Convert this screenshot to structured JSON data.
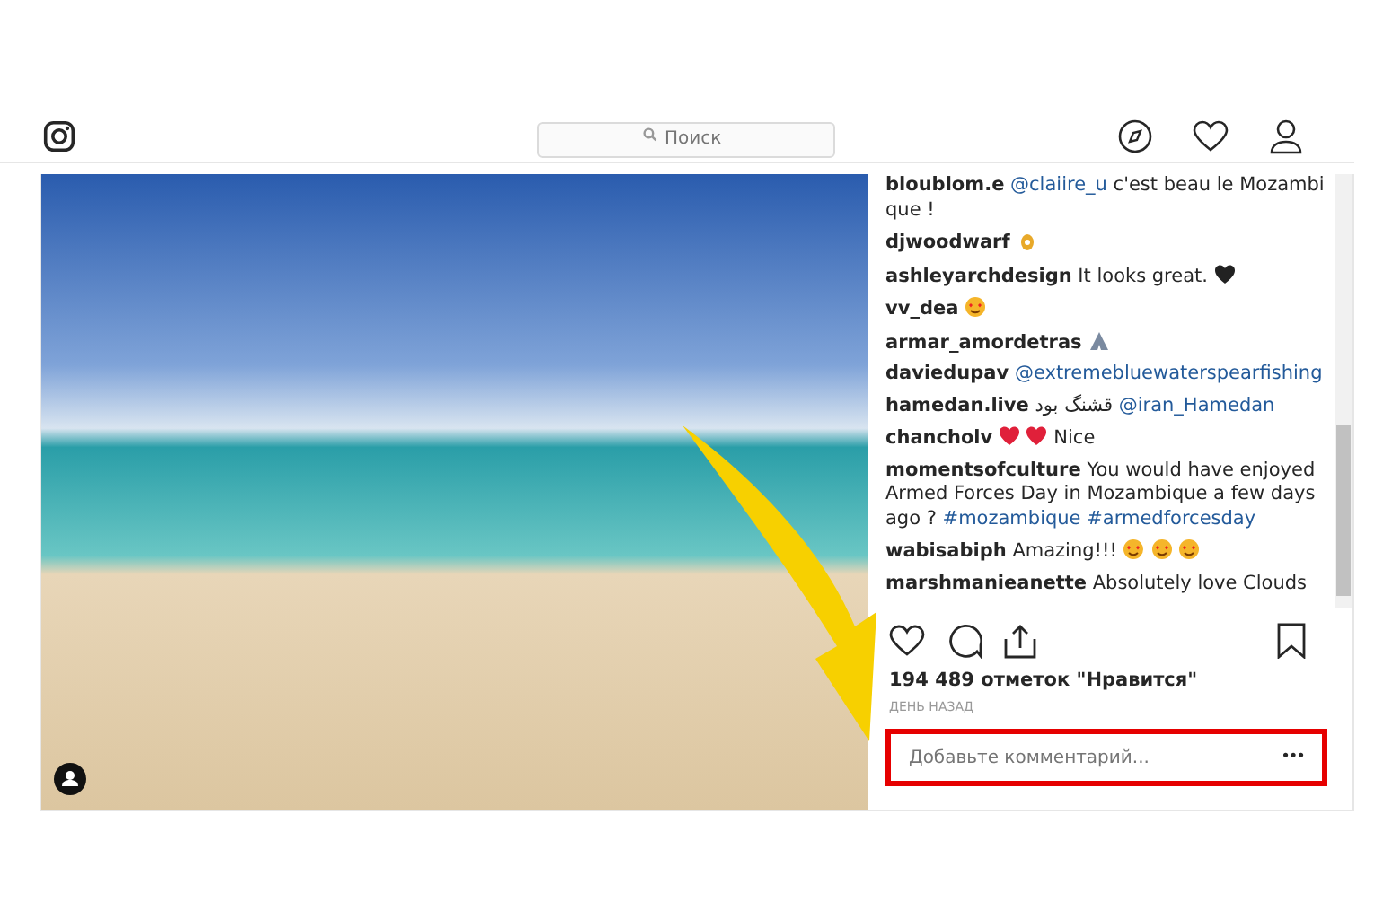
{
  "header": {
    "search": {
      "placeholder": "Поиск"
    }
  },
  "comments": [
    {
      "user": "bloublom.e",
      "parts": [
        {
          "kind": "mention",
          "text": "@claiire_u"
        },
        {
          "kind": "text",
          "text": "c'est beau le Mozambique !"
        }
      ]
    },
    {
      "user": "djwoodwarf",
      "parts": [
        {
          "kind": "ok-hand"
        }
      ]
    },
    {
      "user": "ashleyarchdesign",
      "parts": [
        {
          "kind": "text",
          "text": "It looks great."
        },
        {
          "kind": "black-heart"
        }
      ]
    },
    {
      "user": "vv_dea",
      "parts": [
        {
          "kind": "heart-eyes"
        }
      ]
    },
    {
      "user": "armar_amordetras",
      "parts": [
        {
          "kind": "pray"
        }
      ]
    },
    {
      "user": "daviedupav",
      "parts": [
        {
          "kind": "mention",
          "text": "@extremebluewaterspearfishing"
        }
      ]
    },
    {
      "user": "hamedan.live",
      "parts": [
        {
          "kind": "text",
          "text": "قشنگ بود"
        },
        {
          "kind": "mention",
          "text": "@iran_Hamedan"
        }
      ]
    },
    {
      "user": "chancholv",
      "parts": [
        {
          "kind": "red-heart"
        },
        {
          "kind": "red-heart"
        },
        {
          "kind": "text",
          "text": "Nice"
        }
      ]
    },
    {
      "user": "momentsofculture",
      "parts": [
        {
          "kind": "text",
          "text": "You would have enjoyed Armed Forces Day in Mozambique a few days ago ?"
        },
        {
          "kind": "mention",
          "text": "#mozambique"
        },
        {
          "kind": "mention",
          "text": "#armedforcesday"
        }
      ]
    },
    {
      "user": "wabisabiph",
      "parts": [
        {
          "kind": "text",
          "text": "Amazing!!!"
        },
        {
          "kind": "heart-eyes"
        },
        {
          "kind": "heart-eyes"
        },
        {
          "kind": "heart-eyes"
        }
      ]
    },
    {
      "user": "marshmanieanette",
      "parts": [
        {
          "kind": "text",
          "text": "Absolutely love Clouds"
        }
      ]
    }
  ],
  "likes": "194 489 отметок \"Нравится\"",
  "time": "ДЕНЬ НАЗАД",
  "comment_field": {
    "placeholder": "Добавьте комментарий...",
    "more": "•••"
  }
}
